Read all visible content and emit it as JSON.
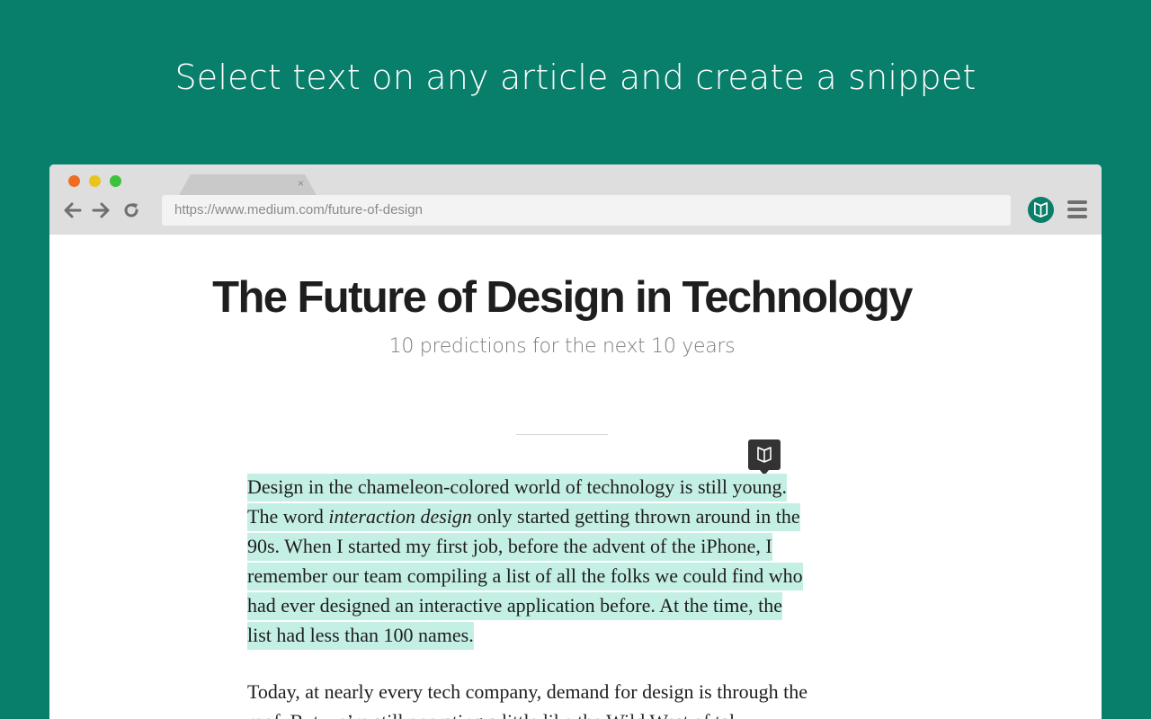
{
  "headline": "Select text on any article and create a snippet",
  "browser": {
    "tab_close": "×",
    "url": "https://www.medium.com/future-of-design",
    "icons": {
      "back": "arrow-left-icon",
      "forward": "arrow-right-icon",
      "reload": "reload-icon",
      "extension": "open-book-icon",
      "menu": "hamburger-menu-icon"
    }
  },
  "article": {
    "title": "The Future of Design in Technology",
    "subtitle": "10 predictions for the next 10 years",
    "paragraph1": {
      "line1": "Design in the chameleon-colored world of technology is still young.",
      "line2_before": "The word ",
      "line2_italic": "interaction design",
      "line2_after": " only started getting thrown around in the",
      "line3": "90s. When I started my first job, before the advent of the iPhone, I",
      "line4": "remember our team compiling a list of all the folks we could find who",
      "line5": "had ever designed an interactive application before. At the time, the",
      "line6": "list had less than 100 names."
    },
    "paragraph2": {
      "line1": "Today, at nearly every tech company, demand for design is through the",
      "line2": "roof. But we’re still operating a little like the Wild West of tal..."
    }
  },
  "colors": {
    "background": "#087f6a",
    "highlight": "#c4efe4",
    "chrome": "#dedede"
  }
}
